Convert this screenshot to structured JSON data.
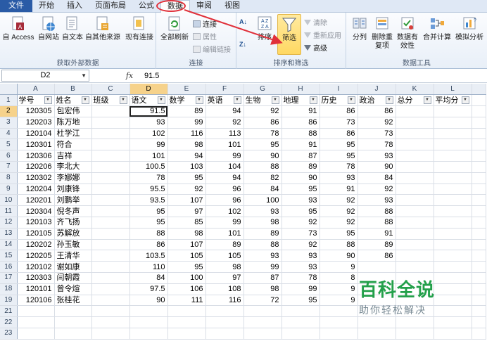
{
  "tabs": [
    "文件",
    "开始",
    "插入",
    "页面布局",
    "公式",
    "数据",
    "审阅",
    "视图"
  ],
  "ribbon": {
    "ext": {
      "access": "自 Access",
      "web": "自网站",
      "text": "自文本",
      "other": "自其他来源",
      "existing": "现有连接",
      "title": "获取外部数据"
    },
    "conn": {
      "refresh": "全部刷新",
      "connections": "连接",
      "properties": "属性",
      "editlinks": "编辑链接",
      "title": "连接"
    },
    "sort": {
      "sort": "排序",
      "filter": "筛选",
      "clear": "清除",
      "reapply": "重新应用",
      "advanced": "高级",
      "title": "排序和筛选"
    },
    "tools": {
      "split": "分列",
      "dedup": "删除重复项",
      "validation": "数据有效性",
      "consolidate": "合并计算",
      "whatif": "模拟分析",
      "title": "数据工具"
    }
  },
  "formula": {
    "cell": "D2",
    "fx": "fx",
    "value": "91.5"
  },
  "sheet": {
    "columns": [
      "A",
      "B",
      "C",
      "D",
      "E",
      "F",
      "G",
      "H",
      "I",
      "J",
      "K",
      "L"
    ],
    "selected_column": "D",
    "selected_row": 2,
    "headers": [
      "学号",
      "姓名",
      "班级",
      "语文",
      "数学",
      "英语",
      "生物",
      "地理",
      "历史",
      "政治",
      "总分",
      "平均分"
    ],
    "rows": [
      [
        "120305",
        "包宏伟",
        "",
        "91.5",
        "89",
        "94",
        "92",
        "91",
        "86",
        "86",
        "",
        ""
      ],
      [
        "120203",
        "陈万地",
        "",
        "93",
        "99",
        "92",
        "86",
        "86",
        "73",
        "92",
        "",
        ""
      ],
      [
        "120104",
        "杜学江",
        "",
        "102",
        "116",
        "113",
        "78",
        "88",
        "86",
        "73",
        "",
        ""
      ],
      [
        "120301",
        "符合",
        "",
        "99",
        "98",
        "101",
        "95",
        "91",
        "95",
        "78",
        "",
        ""
      ],
      [
        "120306",
        "吉祥",
        "",
        "101",
        "94",
        "99",
        "90",
        "87",
        "95",
        "93",
        "",
        ""
      ],
      [
        "120206",
        "李北大",
        "",
        "100.5",
        "103",
        "104",
        "88",
        "89",
        "78",
        "90",
        "",
        ""
      ],
      [
        "120302",
        "李娜娜",
        "",
        "78",
        "95",
        "94",
        "82",
        "90",
        "93",
        "84",
        "",
        ""
      ],
      [
        "120204",
        "刘康锋",
        "",
        "95.5",
        "92",
        "96",
        "84",
        "95",
        "91",
        "92",
        "",
        ""
      ],
      [
        "120201",
        "刘鹏举",
        "",
        "93.5",
        "107",
        "96",
        "100",
        "93",
        "92",
        "93",
        "",
        ""
      ],
      [
        "120304",
        "倪冬声",
        "",
        "95",
        "97",
        "102",
        "93",
        "95",
        "92",
        "88",
        "",
        ""
      ],
      [
        "120103",
        "齐飞扬",
        "",
        "95",
        "85",
        "99",
        "98",
        "92",
        "92",
        "88",
        "",
        ""
      ],
      [
        "120105",
        "苏解放",
        "",
        "88",
        "98",
        "101",
        "89",
        "73",
        "95",
        "91",
        "",
        ""
      ],
      [
        "120202",
        "孙玉敏",
        "",
        "86",
        "107",
        "89",
        "88",
        "92",
        "88",
        "89",
        "",
        ""
      ],
      [
        "120205",
        "王清华",
        "",
        "103.5",
        "105",
        "105",
        "93",
        "93",
        "90",
        "86",
        "",
        ""
      ],
      [
        "120102",
        "谢如康",
        "",
        "110",
        "95",
        "98",
        "99",
        "93",
        "9",
        "",
        "",
        ""
      ],
      [
        "120303",
        "闫朝霞",
        "",
        "84",
        "100",
        "97",
        "87",
        "78",
        "8",
        "",
        "",
        ""
      ],
      [
        "120101",
        "曾令煊",
        "",
        "97.5",
        "106",
        "108",
        "98",
        "99",
        "9",
        "",
        "",
        ""
      ],
      [
        "120106",
        "张桂花",
        "",
        "90",
        "111",
        "116",
        "72",
        "95",
        "9",
        "",
        "",
        ""
      ]
    ],
    "blank_rows": [
      21,
      22,
      23
    ]
  },
  "watermark": {
    "title": "百科全说",
    "subtitle": "助你轻松解决"
  }
}
